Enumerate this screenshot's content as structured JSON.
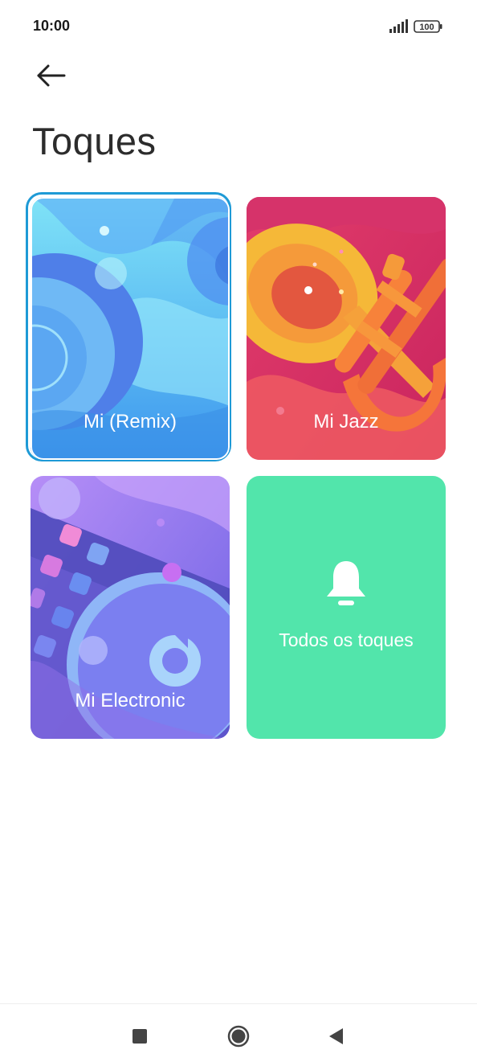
{
  "status_bar": {
    "time": "10:00",
    "battery": "100",
    "icons": [
      "signal-icon",
      "battery-icon"
    ]
  },
  "header": {
    "back_icon": "arrow-left-icon",
    "title": "Toques"
  },
  "cards": [
    {
      "label": "Mi (Remix)",
      "selected": true
    },
    {
      "label": "Mi Jazz",
      "selected": false
    },
    {
      "label": "Mi Electronic",
      "selected": false
    },
    {
      "label": "Todos os toques",
      "icon": "bell-icon"
    }
  ],
  "colors": {
    "selected_border": "#1e9ad6",
    "all_ringtones_bg": "#52e5ab"
  },
  "nav_bar": {
    "icons": [
      "recents-square-icon",
      "home-circle-icon",
      "back-triangle-icon"
    ]
  }
}
